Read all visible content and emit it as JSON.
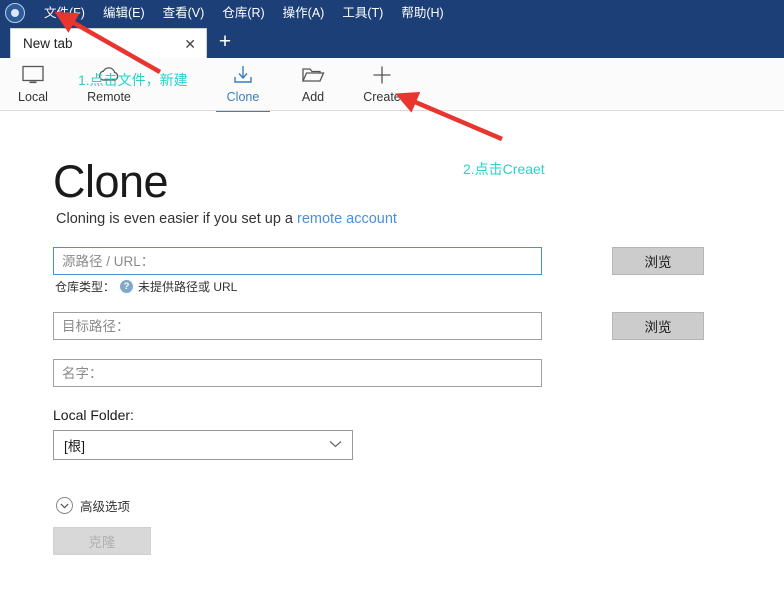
{
  "window": {
    "logo_icon": "sourcetree-logo-icon",
    "menus": [
      {
        "label": "文件(F)"
      },
      {
        "label": "编辑(E)"
      },
      {
        "label": "查看(V)"
      },
      {
        "label": "仓库(R)"
      },
      {
        "label": "操作(A)"
      },
      {
        "label": "工具(T)"
      },
      {
        "label": "帮助(H)"
      }
    ],
    "titlebar_color": "#1b3f76"
  },
  "tabs": {
    "items": [
      {
        "label": "New tab",
        "close_glyph": "✕",
        "active": true
      }
    ],
    "new_tab_glyph": "+"
  },
  "toolbar": {
    "buttons": [
      {
        "label": "Local",
        "icon": "monitor-icon",
        "active": false
      },
      {
        "label": "Remote",
        "icon": "cloud-icon",
        "active": false
      },
      {
        "label": "Clone",
        "icon": "download-tray-icon",
        "active": true
      },
      {
        "label": "Add",
        "icon": "folder-open-icon",
        "active": false
      },
      {
        "label": "Create",
        "icon": "plus-icon",
        "active": false
      }
    ],
    "active_color": "#3a7ebf"
  },
  "main": {
    "title": "Clone",
    "subtitle_prefix": "Cloning is even easier if you set up a ",
    "subtitle_link": "remote account",
    "link_color": "#4a90d9",
    "fields": [
      {
        "name": "source-url",
        "placeholder": "源路径 / URL：",
        "value": "",
        "focused": true,
        "browse_label": "浏览"
      },
      {
        "name": "destination-path",
        "placeholder": "目标路径：",
        "value": "",
        "focused": false,
        "browse_label": "浏览"
      },
      {
        "name": "repository-name",
        "placeholder": "名字：",
        "value": "",
        "focused": false,
        "browse_label": null
      }
    ],
    "repo_type_label": "仓库类型：",
    "repo_type_icon": "help-question-icon",
    "repo_type_status": "未提供路径或 URL",
    "local_folder_label": "Local Folder:",
    "local_folder_value": "[根]",
    "local_folder_arrow": "⌄",
    "advanced_label": "高级选项",
    "advanced_arrow": "⌄",
    "clone_button_label": "克隆",
    "clone_button_disabled": true
  },
  "annotations": {
    "color": "#2ad2c9",
    "arrow_color": "#e8352e",
    "items": [
      {
        "id": "anno1",
        "text": "1.点击文件，新建"
      },
      {
        "id": "anno2",
        "text": "2.点击Creaet"
      }
    ]
  }
}
